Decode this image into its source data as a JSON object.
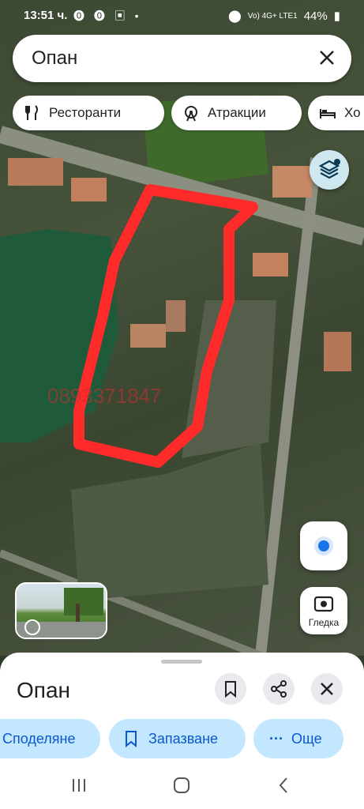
{
  "status_bar": {
    "time": "13:51 ч.",
    "app_icons": "⓿ ⓿ ▣ •",
    "network": "Vo) 4G+ LTE1",
    "battery": "44%"
  },
  "search": {
    "query": "Опан"
  },
  "chips": [
    {
      "label": "Ресторанти",
      "icon": "fork-knife-icon"
    },
    {
      "label": "Атракции",
      "icon": "ferris-wheel-icon"
    },
    {
      "label": "Хо",
      "icon": "bed-icon"
    }
  ],
  "map": {
    "watermark_text": "0893371847",
    "highlight_color": "#ff2a2a"
  },
  "lens_button": {
    "label": "Гледка"
  },
  "place_sheet": {
    "title": "Опан",
    "actions": [
      {
        "label": "Споделяне",
        "icon": "share-icon"
      },
      {
        "label": "Запазване",
        "icon": "bookmark-icon"
      },
      {
        "label": "Още",
        "icon": "more-dots-icon"
      }
    ]
  },
  "colors": {
    "accent_chip": "#c2e7ff",
    "accent_text": "#0b57d0",
    "location_dot": "#1a73e8"
  }
}
